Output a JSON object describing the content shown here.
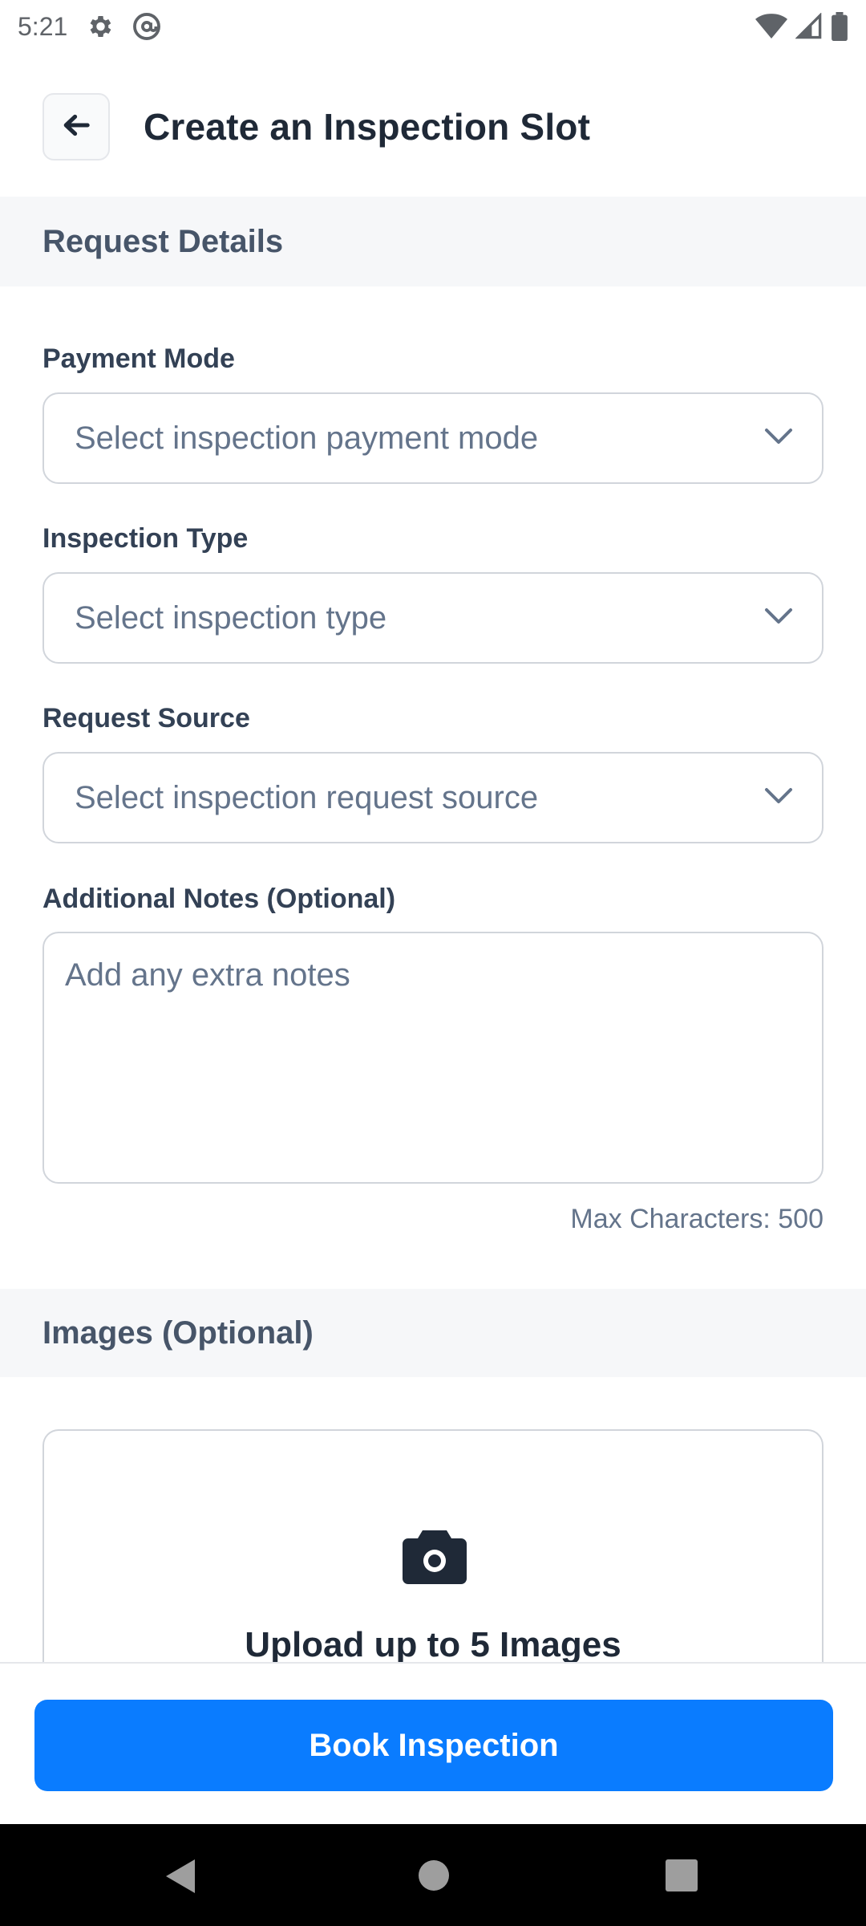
{
  "status_bar": {
    "time": "5:21",
    "icons_left": [
      "gear-icon",
      "at-sign-icon"
    ],
    "icons_right": [
      "wifi-icon",
      "signal-icon",
      "battery-icon"
    ]
  },
  "header": {
    "back_icon": "arrow-left-icon",
    "title": "Create an Inspection Slot"
  },
  "sections": {
    "request_details": "Request Details",
    "images": "Images (Optional)"
  },
  "fields": {
    "payment_mode": {
      "label": "Payment Mode",
      "placeholder": "Select inspection payment mode"
    },
    "inspection_type": {
      "label": "Inspection Type",
      "placeholder": "Select inspection type"
    },
    "request_source": {
      "label": "Request Source",
      "placeholder": "Select inspection request source"
    },
    "notes": {
      "label": "Additional Notes (Optional)",
      "placeholder": "Add any extra notes",
      "helper": "Max Characters: 500"
    }
  },
  "upload": {
    "icon": "camera-icon",
    "title": "Upload up to 5 Images"
  },
  "actions": {
    "book_label": "Book Inspection"
  },
  "nav": {
    "icons": [
      "back-triangle-icon",
      "home-circle-icon",
      "recents-square-icon"
    ]
  },
  "colors": {
    "primary": "#0a7cff",
    "section_bg": "#f6f7f9",
    "border": "#d1d5db",
    "placeholder": "#64748b"
  }
}
